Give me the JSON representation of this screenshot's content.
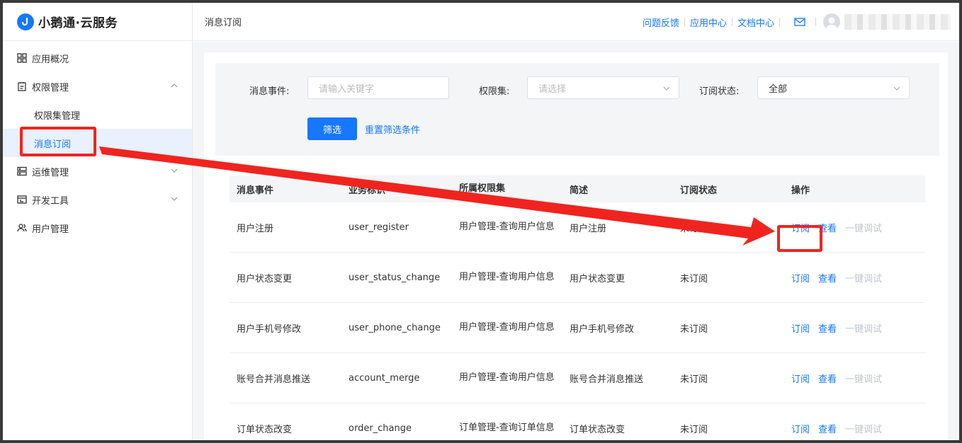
{
  "app": {
    "brand": "小鹅通·云服务"
  },
  "sidebar": {
    "items": [
      {
        "label": "应用概况",
        "icon": "grid-icon"
      },
      {
        "label": "权限管理",
        "icon": "clipboard-icon",
        "expanded": true,
        "children": [
          {
            "label": "权限集管理"
          },
          {
            "label": "消息订阅",
            "active": true
          }
        ]
      },
      {
        "label": "运维管理",
        "icon": "server-icon"
      },
      {
        "label": "开发工具",
        "icon": "tools-icon"
      },
      {
        "label": "用户管理",
        "icon": "users-icon"
      }
    ]
  },
  "header": {
    "breadcrumb": "消息订阅",
    "links": [
      "问题反馈",
      "应用中心",
      "文档中心"
    ]
  },
  "filters": {
    "event_label": "消息事件:",
    "event_placeholder": "请输入关键字",
    "perm_label": "权限集:",
    "perm_placeholder": "请选择",
    "status_label": "订阅状态:",
    "status_value": "全部",
    "submit": "筛选",
    "reset": "重置筛选条件"
  },
  "table": {
    "columns": [
      "消息事件",
      "业务标识",
      "所属权限集",
      "简述",
      "订阅状态",
      "操作"
    ],
    "rows": [
      {
        "event": "用户注册",
        "key": "user_register",
        "perm": "用户管理-查询用户信息",
        "desc": "用户注册",
        "status": "未订阅"
      },
      {
        "event": "用户状态变更",
        "key": "user_status_change",
        "perm": "用户管理-查询用户信息",
        "desc": "用户状态变更",
        "status": "未订阅"
      },
      {
        "event": "用户手机号修改",
        "key": "user_phone_change",
        "perm": "用户管理-查询用户信息",
        "desc": "用户手机号修改",
        "status": "未订阅"
      },
      {
        "event": "账号合并消息推送",
        "key": "account_merge",
        "perm": "用户管理-查询用户信息",
        "desc": "账号合并消息推送",
        "status": "未订阅"
      },
      {
        "event": "订单状态改变",
        "key": "order_change",
        "perm": "订单管理-查询订单信息",
        "desc": "订单状态改变",
        "status": "未订阅"
      }
    ],
    "actions": {
      "subscribe": "订阅",
      "view": "查看",
      "debug": "一键调试"
    }
  },
  "colors": {
    "accent": "#1677ff",
    "highlight": "#f0241f"
  }
}
